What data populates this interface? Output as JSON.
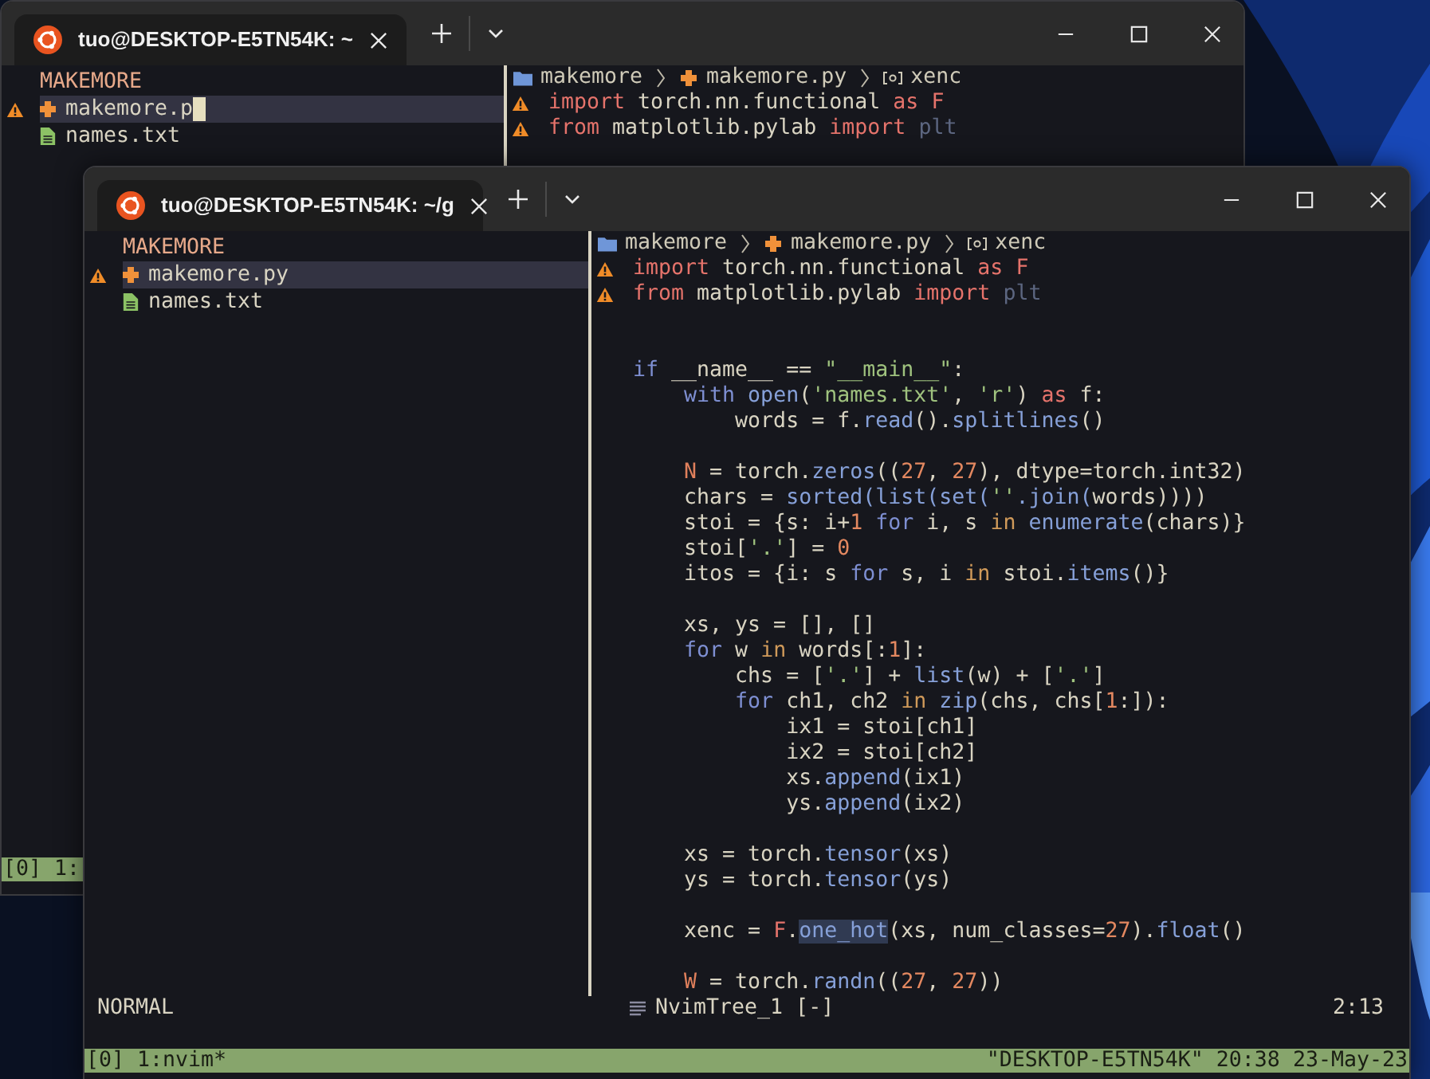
{
  "background_window": {
    "tab": {
      "title": "tuo@DESKTOP-E5TN54K: ~",
      "selected": true
    },
    "tree": {
      "root": "MAKEMORE",
      "items": [
        {
          "name": "makemore.p",
          "kind": "python",
          "selected": true,
          "warning": true,
          "cursor": true
        },
        {
          "name": "names.txt",
          "kind": "text",
          "selected": false,
          "warning": false,
          "cursor": false
        }
      ]
    },
    "breadcrumb": [
      {
        "label": "makemore",
        "kind": "folder"
      },
      {
        "label": "makemore.py",
        "kind": "python"
      },
      {
        "label": "xenc",
        "kind": "variable"
      }
    ],
    "code": [
      {
        "warning": true,
        "tokens": [
          {
            "text": "import",
            "kind": "kw"
          },
          {
            "text": " torch.nn.functional ",
            "kind": "t"
          },
          {
            "text": "as F",
            "kind": "kw"
          }
        ]
      },
      {
        "warning": true,
        "tokens": [
          {
            "text": "from",
            "kind": "kw"
          },
          {
            "text": " matplotlib.pylab ",
            "kind": "t"
          },
          {
            "text": "import",
            "kind": "kw"
          },
          {
            "text": " plt",
            "kind": "dim"
          }
        ]
      }
    ],
    "tmux": {
      "session": "[0] 1:"
    }
  },
  "foreground_window": {
    "tab": {
      "title": "tuo@DESKTOP-E5TN54K: ~/g",
      "selected": true
    },
    "tree": {
      "root": "MAKEMORE",
      "items": [
        {
          "name": "makemore.py",
          "kind": "python",
          "selected": true,
          "warning": true,
          "cursor": false
        },
        {
          "name": "names.txt",
          "kind": "text",
          "selected": false,
          "warning": false,
          "cursor": false
        }
      ]
    },
    "breadcrumb": [
      {
        "label": "makemore",
        "kind": "folder"
      },
      {
        "label": "makemore.py",
        "kind": "python"
      },
      {
        "label": "xenc",
        "kind": "variable"
      }
    ],
    "code": [
      {
        "warning": true,
        "tokens": [
          {
            "text": "import",
            "kind": "kw"
          },
          {
            "text": " torch.nn.functional ",
            "kind": "t"
          },
          {
            "text": "as F",
            "kind": "kw"
          }
        ]
      },
      {
        "warning": true,
        "tokens": [
          {
            "text": "from",
            "kind": "kw"
          },
          {
            "text": " matplotlib.pylab ",
            "kind": "t"
          },
          {
            "text": "import",
            "kind": "kw"
          },
          {
            "text": " plt",
            "kind": "dim"
          }
        ]
      },
      {
        "kind": "blank"
      },
      {
        "kind": "blank"
      },
      {
        "warning": false,
        "tokens": [
          {
            "text": "if",
            "kind": "ctl"
          },
          {
            "text": " __name__ == ",
            "kind": "t"
          },
          {
            "text": "\"__main__\"",
            "kind": "str"
          },
          {
            "text": ":",
            "kind": "t"
          }
        ]
      },
      {
        "warning": false,
        "tokens": [
          {
            "text": "    with",
            "kind": "ctl"
          },
          {
            "text": " open",
            "kind": "fn"
          },
          {
            "text": "(",
            "kind": "t"
          },
          {
            "text": "'names.txt'",
            "kind": "str"
          },
          {
            "text": ", ",
            "kind": "t"
          },
          {
            "text": "'r'",
            "kind": "str"
          },
          {
            "text": ") ",
            "kind": "t"
          },
          {
            "text": "as",
            "kind": "kw"
          },
          {
            "text": " f:",
            "kind": "t"
          }
        ]
      },
      {
        "warning": false,
        "tokens": [
          {
            "text": "        words = f.",
            "kind": "t"
          },
          {
            "text": "read",
            "kind": "fn"
          },
          {
            "text": "().",
            "kind": "t"
          },
          {
            "text": "splitlines",
            "kind": "fn"
          },
          {
            "text": "()",
            "kind": "t"
          }
        ]
      },
      {
        "kind": "blank"
      },
      {
        "warning": false,
        "tokens": [
          {
            "text": "    N",
            "kind": "var"
          },
          {
            "text": " = torch.",
            "kind": "t"
          },
          {
            "text": "zeros",
            "kind": "fn"
          },
          {
            "text": "((",
            "kind": "t"
          },
          {
            "text": "27",
            "kind": "num"
          },
          {
            "text": ", ",
            "kind": "t"
          },
          {
            "text": "27",
            "kind": "num"
          },
          {
            "text": "), dtype=torch.int32)",
            "kind": "t"
          }
        ]
      },
      {
        "warning": false,
        "tokens": [
          {
            "text": "    chars = ",
            "kind": "t"
          },
          {
            "text": "sorted(list(set(",
            "kind": "fn"
          },
          {
            "text": "''",
            "kind": "str"
          },
          {
            "text": ".join(",
            "kind": "fn"
          },
          {
            "text": "words))))",
            "kind": "t"
          }
        ]
      },
      {
        "warning": false,
        "tokens": [
          {
            "text": "    stoi = {s: i+",
            "kind": "t"
          },
          {
            "text": "1 ",
            "kind": "num"
          },
          {
            "text": "for",
            "kind": "ctl"
          },
          {
            "text": " i, s ",
            "kind": "t"
          },
          {
            "text": "in",
            "kind": "op"
          },
          {
            "text": " enumerate",
            "kind": "fn"
          },
          {
            "text": "(chars)}",
            "kind": "t"
          }
        ]
      },
      {
        "warning": false,
        "tokens": [
          {
            "text": "    stoi[",
            "kind": "t"
          },
          {
            "text": "'.'",
            "kind": "str"
          },
          {
            "text": "] = ",
            "kind": "t"
          },
          {
            "text": "0",
            "kind": "num"
          }
        ]
      },
      {
        "warning": false,
        "tokens": [
          {
            "text": "    itos = {i: s ",
            "kind": "t"
          },
          {
            "text": "for",
            "kind": "ctl"
          },
          {
            "text": " s, i ",
            "kind": "t"
          },
          {
            "text": "in",
            "kind": "op"
          },
          {
            "text": " stoi.",
            "kind": "t"
          },
          {
            "text": "items",
            "kind": "fn"
          },
          {
            "text": "()}",
            "kind": "t"
          }
        ]
      },
      {
        "kind": "blank"
      },
      {
        "warning": false,
        "tokens": [
          {
            "text": "    xs, ys = [], []",
            "kind": "t"
          }
        ]
      },
      {
        "warning": false,
        "tokens": [
          {
            "text": "    for",
            "kind": "ctl"
          },
          {
            "text": " w ",
            "kind": "t"
          },
          {
            "text": "in",
            "kind": "op"
          },
          {
            "text": " words[:",
            "kind": "t"
          },
          {
            "text": "1",
            "kind": "num"
          },
          {
            "text": "]:",
            "kind": "t"
          }
        ]
      },
      {
        "warning": false,
        "tokens": [
          {
            "text": "        chs = [",
            "kind": "t"
          },
          {
            "text": "'.'",
            "kind": "str"
          },
          {
            "text": "] + ",
            "kind": "t"
          },
          {
            "text": "list",
            "kind": "fn"
          },
          {
            "text": "(w) + [",
            "kind": "t"
          },
          {
            "text": "'.'",
            "kind": "str"
          },
          {
            "text": "]",
            "kind": "t"
          }
        ]
      },
      {
        "warning": false,
        "tokens": [
          {
            "text": "        for",
            "kind": "ctl"
          },
          {
            "text": " ch1, ch2 ",
            "kind": "t"
          },
          {
            "text": "in",
            "kind": "op"
          },
          {
            "text": " zip",
            "kind": "fn"
          },
          {
            "text": "(chs, chs[",
            "kind": "t"
          },
          {
            "text": "1",
            "kind": "num"
          },
          {
            "text": ":]):",
            "kind": "t"
          }
        ]
      },
      {
        "warning": false,
        "tokens": [
          {
            "text": "            ix1 = stoi[ch1]",
            "kind": "t"
          }
        ]
      },
      {
        "warning": false,
        "tokens": [
          {
            "text": "            ix2 = stoi[ch2]",
            "kind": "t"
          }
        ]
      },
      {
        "warning": false,
        "tokens": [
          {
            "text": "            xs.",
            "kind": "t"
          },
          {
            "text": "append",
            "kind": "fn"
          },
          {
            "text": "(ix1)",
            "kind": "t"
          }
        ]
      },
      {
        "warning": false,
        "tokens": [
          {
            "text": "            ys.",
            "kind": "t"
          },
          {
            "text": "append",
            "kind": "fn"
          },
          {
            "text": "(ix2)",
            "kind": "t"
          }
        ]
      },
      {
        "kind": "blank"
      },
      {
        "warning": false,
        "tokens": [
          {
            "text": "    xs = torch.",
            "kind": "t"
          },
          {
            "text": "tensor",
            "kind": "fn"
          },
          {
            "text": "(xs)",
            "kind": "t"
          }
        ]
      },
      {
        "warning": false,
        "tokens": [
          {
            "text": "    ys = torch.",
            "kind": "t"
          },
          {
            "text": "tensor",
            "kind": "fn"
          },
          {
            "text": "(ys)",
            "kind": "t"
          }
        ]
      },
      {
        "kind": "blank"
      },
      {
        "warning": false,
        "tokens": [
          {
            "text": "    xenc = ",
            "kind": "t"
          },
          {
            "text": "F",
            "kind": "kw"
          },
          {
            "text": ".",
            "kind": "t"
          },
          {
            "text": "one_hot",
            "kind": "hl"
          },
          {
            "text": "(xs, num_classes=",
            "kind": "t"
          },
          {
            "text": "27",
            "kind": "num"
          },
          {
            "text": ").",
            "kind": "t"
          },
          {
            "text": "float",
            "kind": "fn"
          },
          {
            "text": "()",
            "kind": "t"
          }
        ]
      },
      {
        "kind": "blank"
      },
      {
        "warning": false,
        "tokens": [
          {
            "text": "    W",
            "kind": "var"
          },
          {
            "text": " = torch.",
            "kind": "t"
          },
          {
            "text": "randn",
            "kind": "fn"
          },
          {
            "text": "((",
            "kind": "t"
          },
          {
            "text": "27",
            "kind": "num"
          },
          {
            "text": ", ",
            "kind": "t"
          },
          {
            "text": "27",
            "kind": "num"
          },
          {
            "text": "))",
            "kind": "t"
          }
        ]
      }
    ],
    "status_line": {
      "mode": "NORMAL",
      "buffer": "NvimTree_1 [-]",
      "position": "2:13"
    },
    "tmux": {
      "session": "[0] 1:nvim*",
      "host_time": "\"DESKTOP-E5TN54K\" 20:38 23-May-23"
    }
  }
}
